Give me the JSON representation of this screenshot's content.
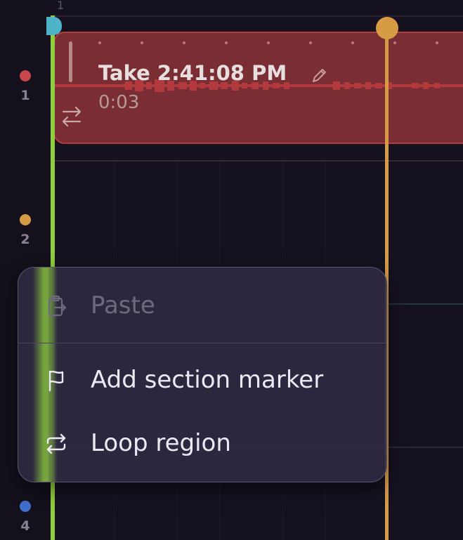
{
  "ruler": {
    "bar_number": "1"
  },
  "tracks": [
    {
      "number": "1",
      "color": "#c8474b"
    },
    {
      "number": "2",
      "color": "#d89b45"
    },
    {
      "number": "4",
      "color": "#3f6fcf"
    }
  ],
  "region": {
    "title": "Take 2:41:08 PM",
    "duration": "0:03",
    "color": "#7a2d33",
    "border_color": "#b13c3f"
  },
  "playheads": {
    "primary_color": "#8fce3f",
    "secondary_color": "#d89b45"
  },
  "context_menu": {
    "items": [
      {
        "label": "Paste",
        "icon": "paste-icon",
        "enabled": false
      },
      {
        "label": "Add section marker",
        "icon": "flag-icon",
        "enabled": true
      },
      {
        "label": "Loop region",
        "icon": "loop-icon",
        "enabled": true
      }
    ]
  }
}
